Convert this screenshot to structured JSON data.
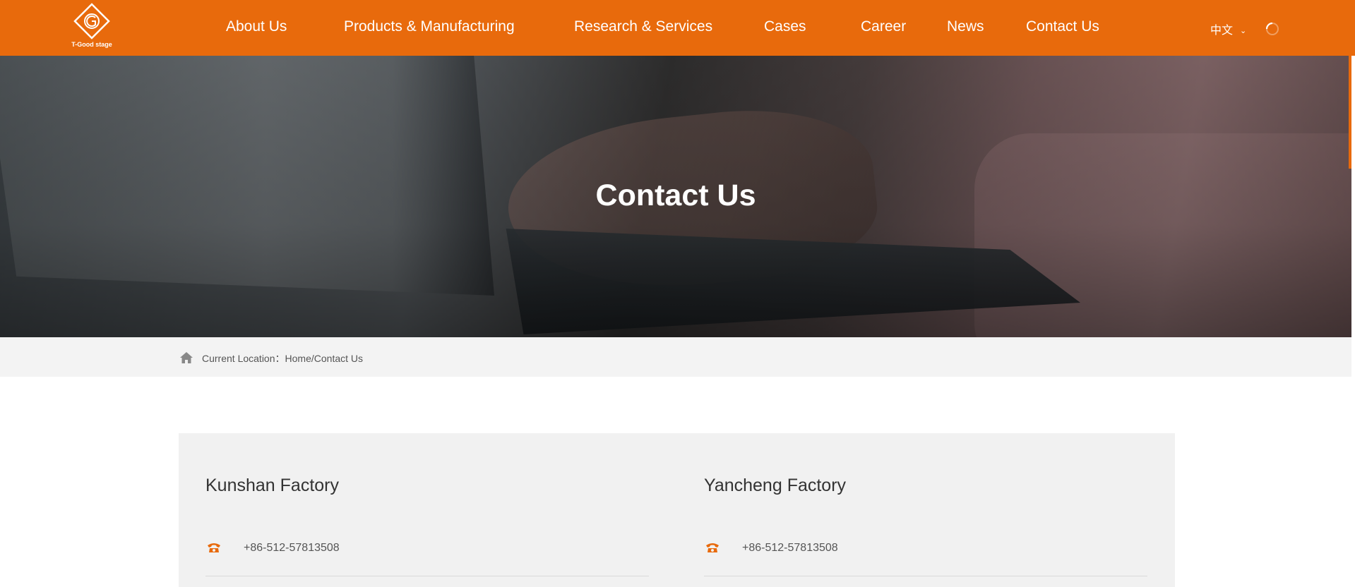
{
  "header": {
    "logo_text": "T-Good stage",
    "nav": [
      "About Us",
      "Products & Manufacturing",
      "Research & Services",
      "Cases",
      "Career",
      "News",
      "Contact Us"
    ],
    "language": "中文",
    "icons": {
      "chevron": "chevron-down-icon",
      "loading": "spinner-icon"
    }
  },
  "hero": {
    "title": "Contact Us"
  },
  "breadcrumb": {
    "label": "Current Location：",
    "home": "Home",
    "separator": "/",
    "current": "Contact Us"
  },
  "factories": [
    {
      "name": "Kunshan Factory",
      "phone": "+86-512-57813508"
    },
    {
      "name": "Yancheng Factory",
      "phone": "+86-512-57813508"
    }
  ],
  "colors": {
    "brand": "#e86a0c",
    "panel": "#f1f1f1",
    "breadcrumb_bar": "#f3f3f3"
  }
}
